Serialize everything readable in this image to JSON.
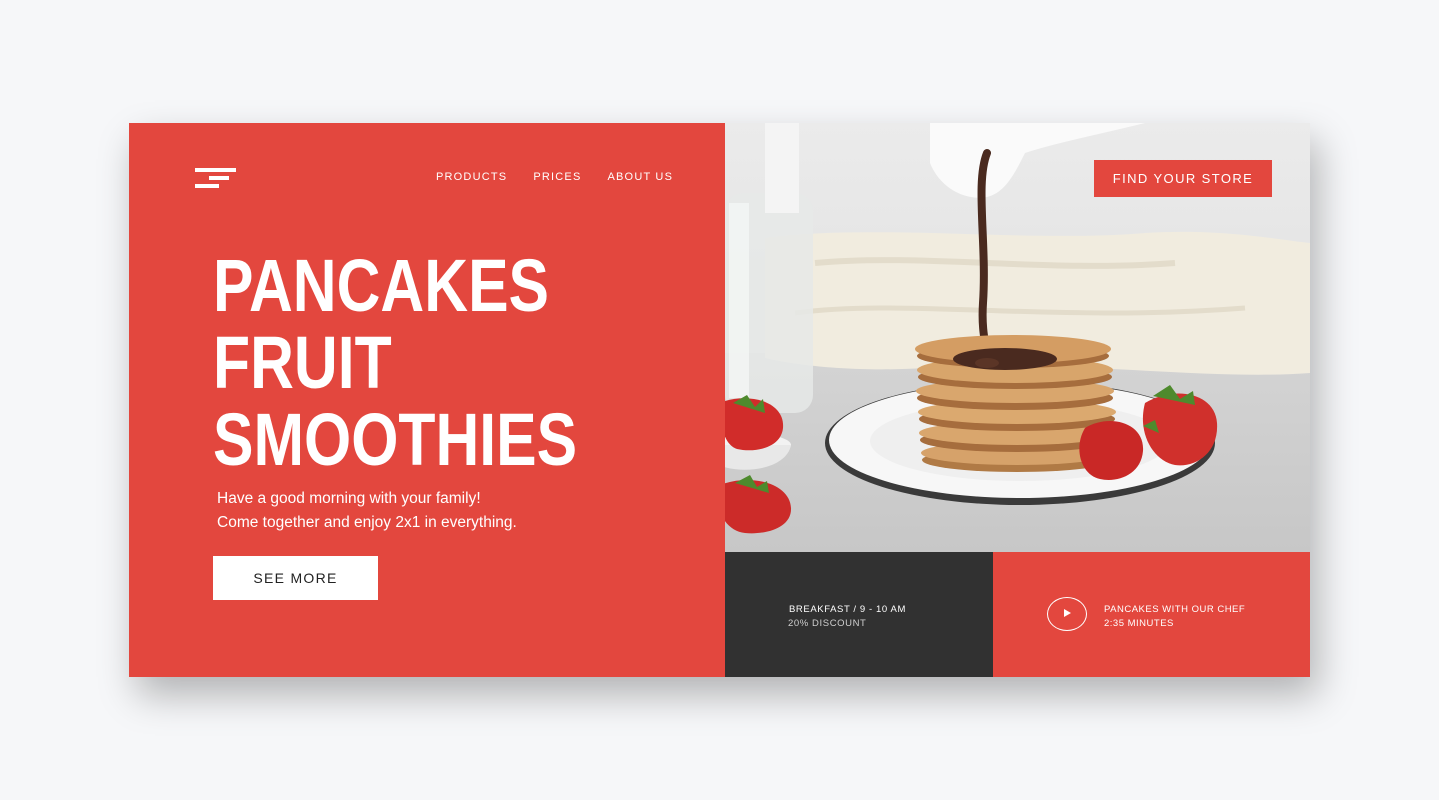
{
  "nav": {
    "items": [
      {
        "label": "PRODUCTS"
      },
      {
        "label": "PRICES"
      },
      {
        "label": "ABOUT US"
      }
    ]
  },
  "hero": {
    "headline": [
      "PANCAKES",
      "FRUIT",
      "SMOOTHIES"
    ],
    "subtitle": [
      "Have a good morning with your family!",
      "Come together and enjoy 2x1 in everything."
    ],
    "cta_label": "SEE MORE"
  },
  "store_button": "FIND YOUR STORE",
  "breakfast": {
    "title": "BREAKFAST / 9 - 10 AM",
    "detail": "20% DISCOUNT"
  },
  "video": {
    "title": "PANCAKES WITH OUR CHEF",
    "duration": "2:35 MINUTES"
  },
  "icons": {
    "logo": "menu-bars-logo-icon",
    "play": "play-icon"
  },
  "colors": {
    "accent": "#e3473e",
    "dark": "#313131",
    "page_bg": "#f6f7f9"
  }
}
